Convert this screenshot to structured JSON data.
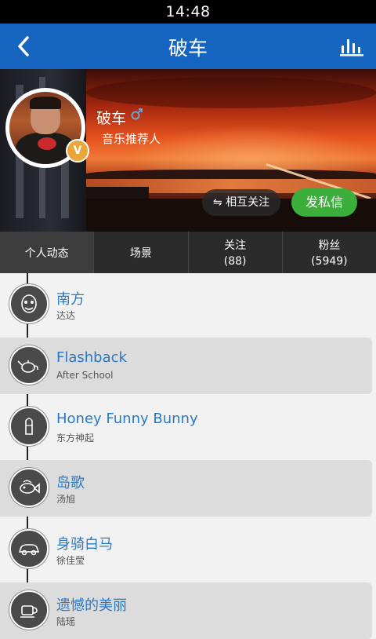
{
  "status": {
    "time": "14:48"
  },
  "header": {
    "title": "破车"
  },
  "profile": {
    "name": "破车",
    "role": "音乐推荐人",
    "badge": "V"
  },
  "buttons": {
    "mutual": "⇋ 相互关注",
    "message": "发私信"
  },
  "tabs": [
    {
      "label": "个人动态",
      "count": ""
    },
    {
      "label": "场景",
      "count": ""
    },
    {
      "label": "关注",
      "count": "(88)"
    },
    {
      "label": "粉丝",
      "count": "(5949)"
    }
  ],
  "songs": [
    {
      "title": "南方",
      "artist": "达达",
      "icon": "mask-icon"
    },
    {
      "title": "Flashback",
      "artist": "After School",
      "icon": "teapot-icon"
    },
    {
      "title": "Honey Funny Bunny",
      "artist": "东方神起",
      "icon": "cone-icon"
    },
    {
      "title": "岛歌",
      "artist": "汤旭",
      "icon": "fish-icon"
    },
    {
      "title": "身骑白马",
      "artist": "徐佳莹",
      "icon": "car-icon"
    },
    {
      "title": "遗憾的美丽",
      "artist": "陆瑶",
      "icon": "cup-icon"
    }
  ],
  "colors": {
    "appbar": "#1565c0",
    "link": "#2b78c5",
    "message_button": "#3cae3c",
    "badge": "#e9a63a"
  }
}
